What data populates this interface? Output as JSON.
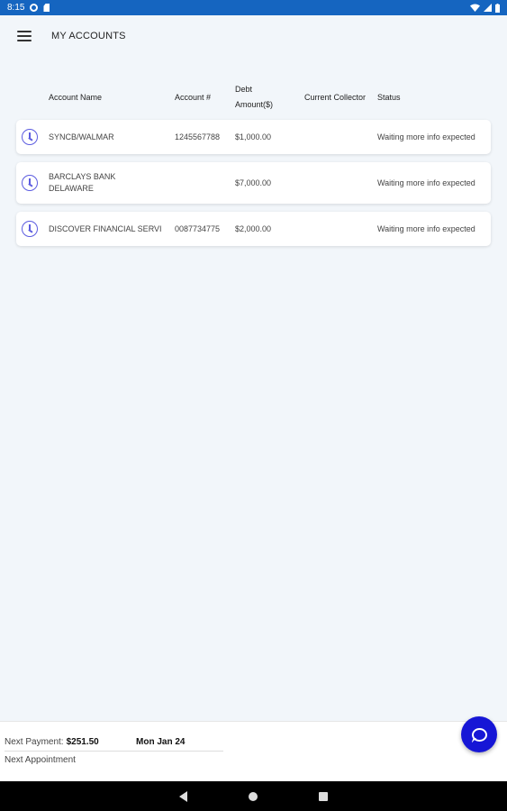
{
  "status_bar": {
    "time": "8:15",
    "icons": [
      "gear-icon",
      "sd-card-icon",
      "wifi-icon",
      "signal-icon",
      "battery-icon"
    ]
  },
  "header": {
    "title": "MY ACCOUNTS",
    "menu_icon": "hamburger-menu-icon"
  },
  "table": {
    "columns": {
      "account_name": "Account Name",
      "account_num": "Account #",
      "debt_amount": "Debt Amount($)",
      "collector": "Current Collector",
      "status": "Status"
    },
    "rows": [
      {
        "name": "SYNCB/WALMAR",
        "number": "1245567788",
        "amount": "$1,000.00",
        "collector": "",
        "status": "Waiting more info expected",
        "icon": "clock-icon"
      },
      {
        "name": "BARCLAYS BANK DELAWARE",
        "number": "",
        "amount": "$7,000.00",
        "collector": "",
        "status": "Waiting more info expected",
        "icon": "clock-icon"
      },
      {
        "name": "DISCOVER FINANCIAL SERVI",
        "number": "0087734775",
        "amount": "$2,000.00",
        "collector": "",
        "status": "Waiting more info expected",
        "icon": "clock-icon"
      }
    ]
  },
  "footer": {
    "next_payment_label": "Next Payment:",
    "next_payment_amount": "$251.50",
    "next_payment_date": "Mon Jan 24",
    "next_appointment_label": "Next Appointment"
  },
  "chat_button": {
    "icon": "chat-icon",
    "color": "#1616d6"
  },
  "colors": {
    "status_bar": "#1565c0",
    "background": "#f2f6fa",
    "accent": "#5c5ce0"
  }
}
